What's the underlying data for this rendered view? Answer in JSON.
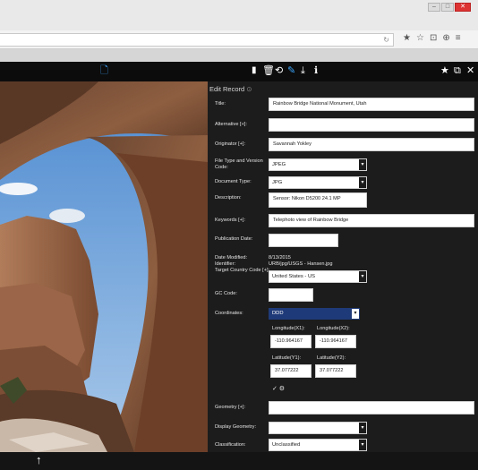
{
  "browser": {
    "win_buttons": [
      "–",
      "□",
      "✕"
    ],
    "reload_icon": "↻",
    "icons": [
      "star-icon",
      "bookmark-icon",
      "save-icon",
      "account-icon",
      "menu-icon"
    ],
    "icon_glyphs": [
      "★",
      "☆",
      "⊡",
      "⊕",
      "≡"
    ]
  },
  "toolbar": {
    "doc_glyph": "🗋",
    "mid_glyphs": [
      "▮",
      "🗑",
      "⟲",
      "✎",
      "⤓",
      "ℹ"
    ],
    "right_glyphs": [
      "★",
      "⧉",
      "✕"
    ]
  },
  "panel": {
    "title": "Edit Record",
    "title_icon": "⊙",
    "fields": {
      "title": {
        "label": "Title:",
        "value": "Rainbow Bridge National Monument, Utah"
      },
      "alternative": {
        "label": "Alternative [+]:",
        "value": ""
      },
      "originator": {
        "label": "Originator [+]:",
        "value": "Savannah Yokley"
      },
      "file_type": {
        "label": "File Type and Version Code:",
        "value": "JPEG"
      },
      "document_type": {
        "label": "Document Type:",
        "value": "JPG"
      },
      "description": {
        "label": "Description:",
        "value": "Sensor: Nikon D5200 24.1 MP"
      },
      "keywords": {
        "label": "Keywords [+]:",
        "value": "Telephoto view of Rainbow Bridge"
      },
      "publication_date": {
        "label": "Publication Date:",
        "value": ""
      },
      "date_modified": {
        "label": "Date Modified:",
        "value": "8/13/2015"
      },
      "identifier": {
        "label": "Identifier:",
        "value": "URB/jpg/USGS - Hansen.jpg"
      },
      "target_country": {
        "label": "Target Country Code [+]:",
        "value": "United States - US"
      },
      "gc_code": {
        "label": "GC Code:",
        "value": ""
      },
      "coordinates": {
        "label": "Coordinates:",
        "value": "DDD"
      },
      "geometry": {
        "label": "Geometry [+]:",
        "value": ""
      },
      "display_geometry": {
        "label": "Display Geometry:",
        "value": ""
      },
      "classification": {
        "label": "Classification:",
        "value": "Unclassified"
      }
    },
    "coords": {
      "lon1_label": "Longitude(X1):",
      "lon1": "-110.964167",
      "lon2_label": "Longitude(X2):",
      "lon2": "-110.964167",
      "lat1_label": "Latitude(Y1):",
      "lat1": "37.077222",
      "lat2_label": "Latitude(Y2):",
      "lat2": "37.077222",
      "tools": "✓ ⚙"
    }
  },
  "bottom": {
    "up_arrow": "↑"
  }
}
